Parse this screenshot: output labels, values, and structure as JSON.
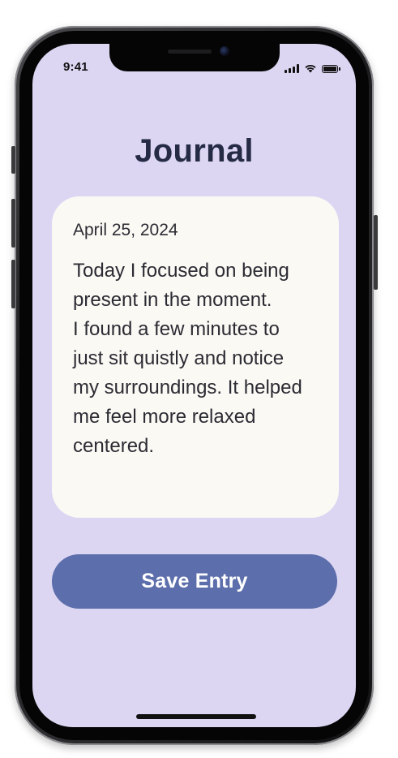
{
  "status_bar": {
    "time": "9:41",
    "icons": [
      "signal-icon",
      "wifi-icon",
      "battery-icon"
    ]
  },
  "header": {
    "title": "Journal"
  },
  "entry": {
    "date": "April 25, 2024",
    "text": "Today I focused on being\npresent in the moment.\nI found a few minutes to\njust sit quistly and notice\nmy surroundings. It helped\nme feel more relaxed\ncentered."
  },
  "actions": {
    "save_label": "Save Entry"
  },
  "colors": {
    "screen_background": "#dcd6f3",
    "card_background": "#fbf9f4",
    "button_background": "#5c6eab",
    "title_text": "#262b45"
  }
}
